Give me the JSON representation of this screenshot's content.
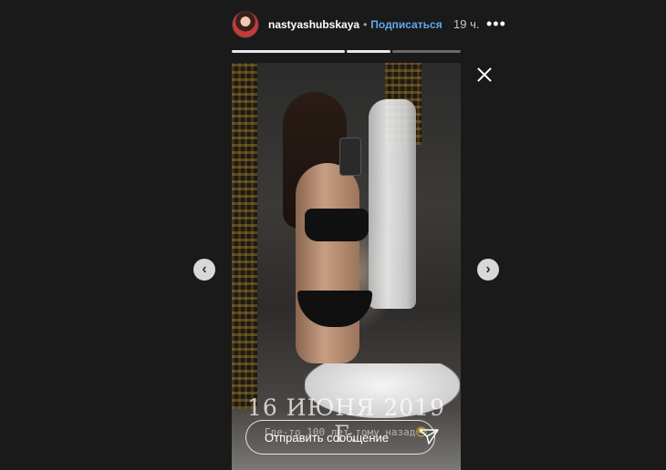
{
  "header": {
    "username": "nastyashubskaya",
    "separator": "•",
    "follow_label": "Подписаться",
    "time": "19 ч.",
    "more_label": "•••"
  },
  "progress": {
    "segments": 3,
    "current": 2,
    "current_fraction": 1.0
  },
  "story": {
    "date_overlay": "16 ИЮНЯ 2019 Г.",
    "sub_overlay": "Где-то 100 лет тому назад😂"
  },
  "reply": {
    "placeholder": "Отправить сообщение"
  },
  "icons": {
    "close": "close-icon",
    "prev": "chevron-left-icon",
    "next": "chevron-right-icon",
    "send": "paper-plane-icon",
    "more": "more-icon"
  },
  "colors": {
    "background": "#1a1a1a",
    "follow": "#62a8ee",
    "text": "#ffffff"
  }
}
